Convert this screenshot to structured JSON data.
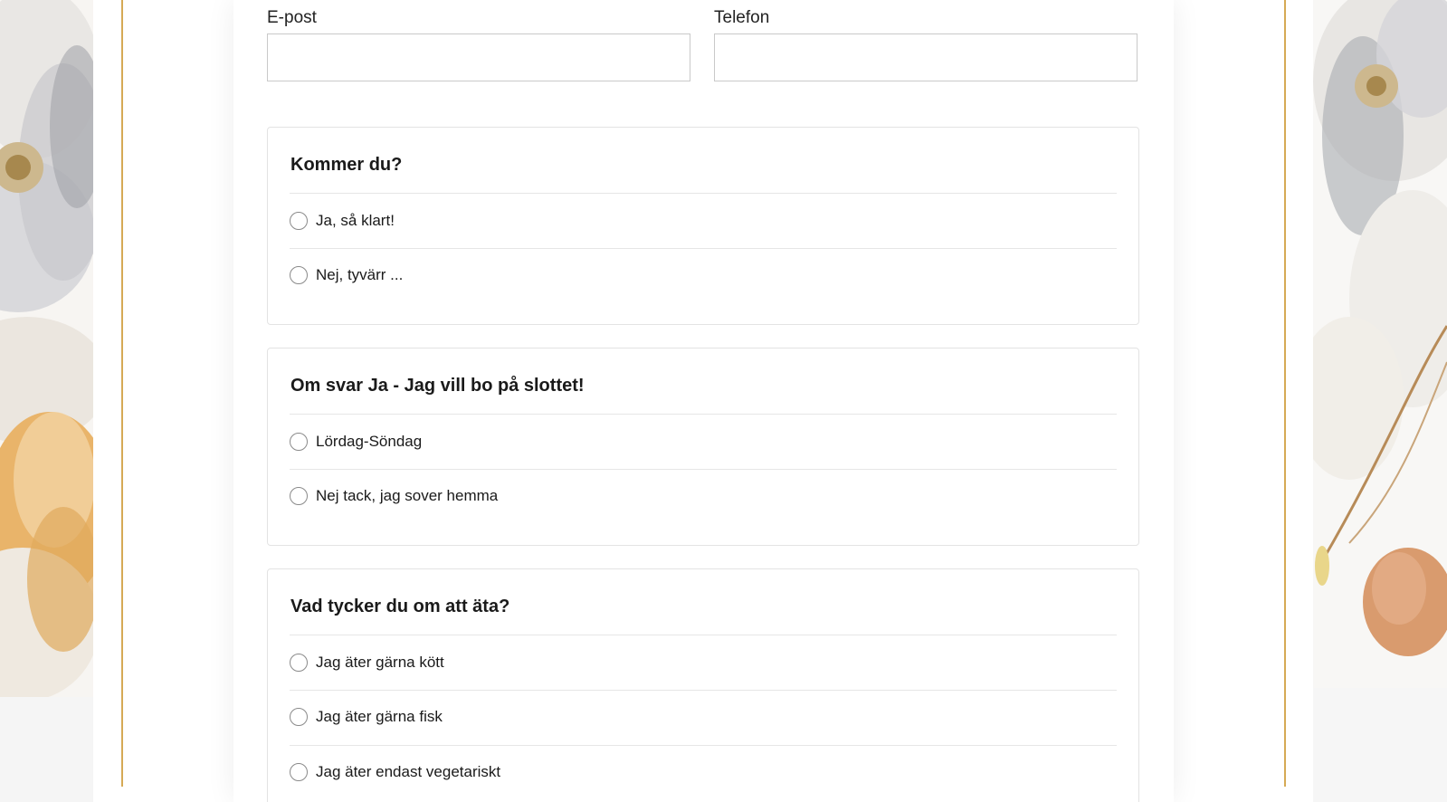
{
  "contact": {
    "email_label": "E-post",
    "email_value": "",
    "phone_label": "Telefon",
    "phone_value": ""
  },
  "questions": [
    {
      "title": "Kommer du?",
      "options": [
        "Ja, så klart!",
        "Nej, tyvärr ..."
      ]
    },
    {
      "title": "Om svar Ja - Jag vill bo på slottet!",
      "options": [
        "Lördag-Söndag",
        "Nej tack, jag sover hemma"
      ]
    },
    {
      "title": "Vad tycker du om att äta?",
      "options": [
        "Jag äter gärna kött",
        "Jag äter gärna fisk",
        "Jag äter endast vegetariskt"
      ]
    }
  ],
  "colors": {
    "accent_gold": "#d6aa55",
    "border": "#e3e3e3",
    "radio_border": "#8a8a8a"
  }
}
